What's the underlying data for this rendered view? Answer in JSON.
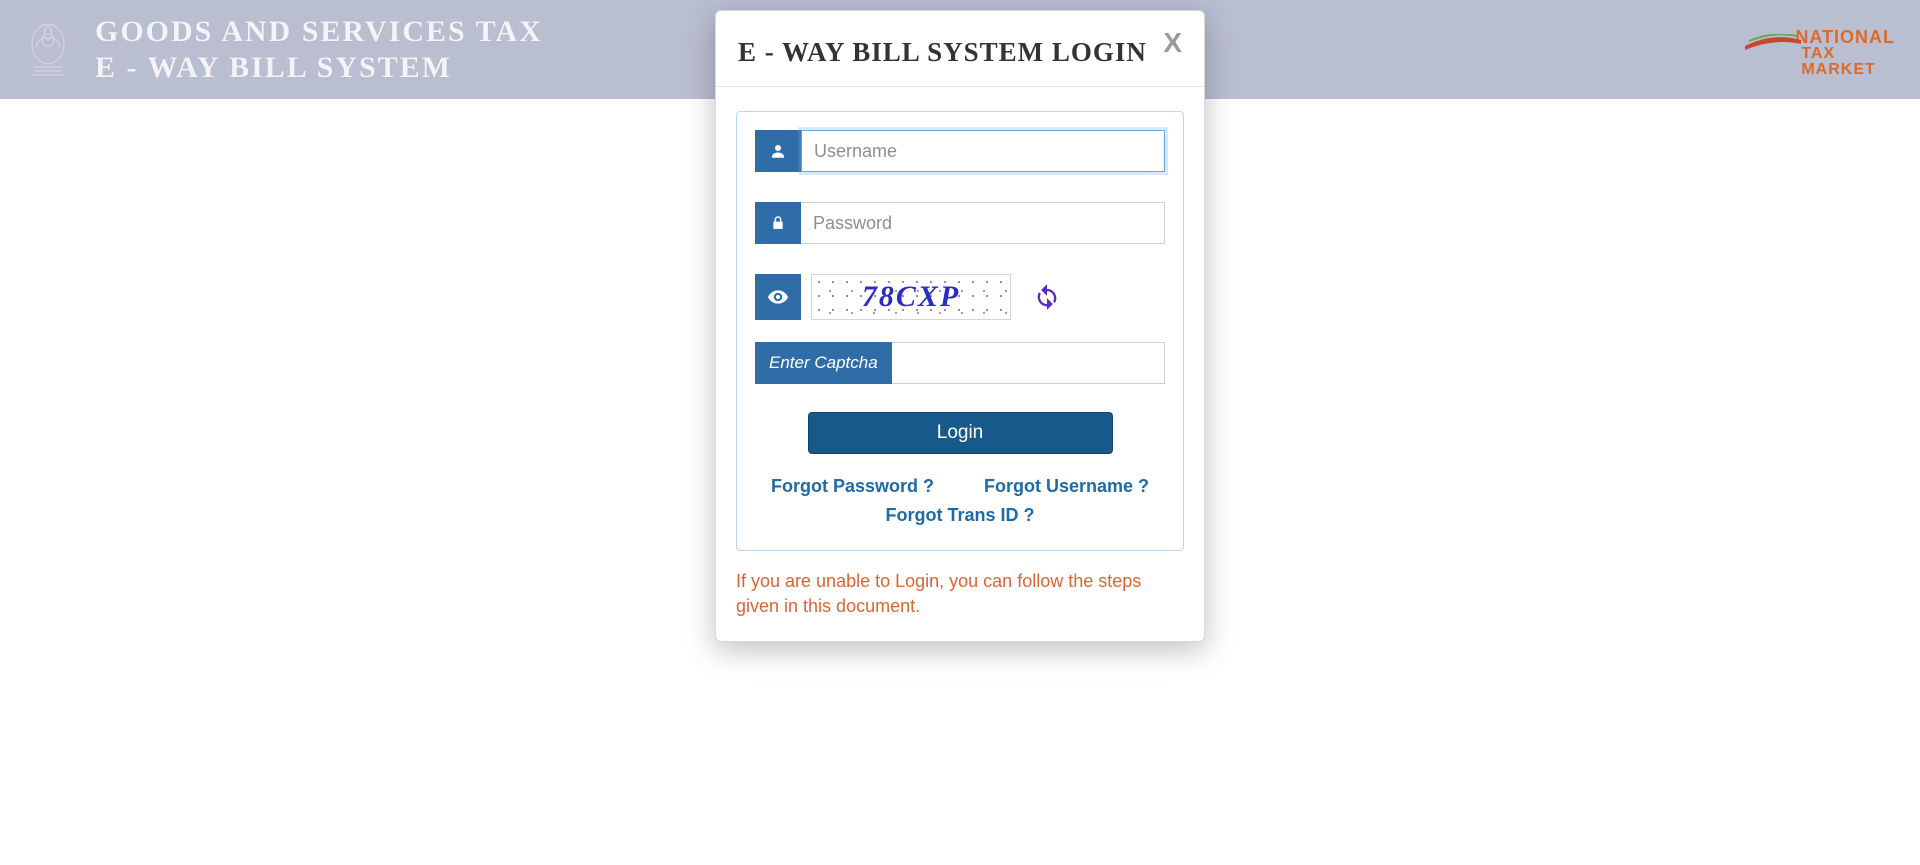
{
  "header": {
    "line1": "GOODS AND SERVICES TAX",
    "line2": "E - WAY BILL SYSTEM",
    "right_logo": {
      "l1": "NATIONAL",
      "l2": "TAX",
      "l3": "MARKET"
    }
  },
  "modal": {
    "title": "E - WAY BILL SYSTEM LOGIN",
    "close": "X",
    "username_placeholder": "Username",
    "password_placeholder": "Password",
    "captcha_value": "78CXP",
    "captcha_label": "Enter Captcha",
    "login_button": "Login",
    "links": {
      "forgot_password": "Forgot Password ?",
      "forgot_username": "Forgot Username ?",
      "forgot_transid": "Forgot Trans ID ?"
    },
    "help_text": "If you are unable to Login, you can follow the steps given in this document."
  }
}
